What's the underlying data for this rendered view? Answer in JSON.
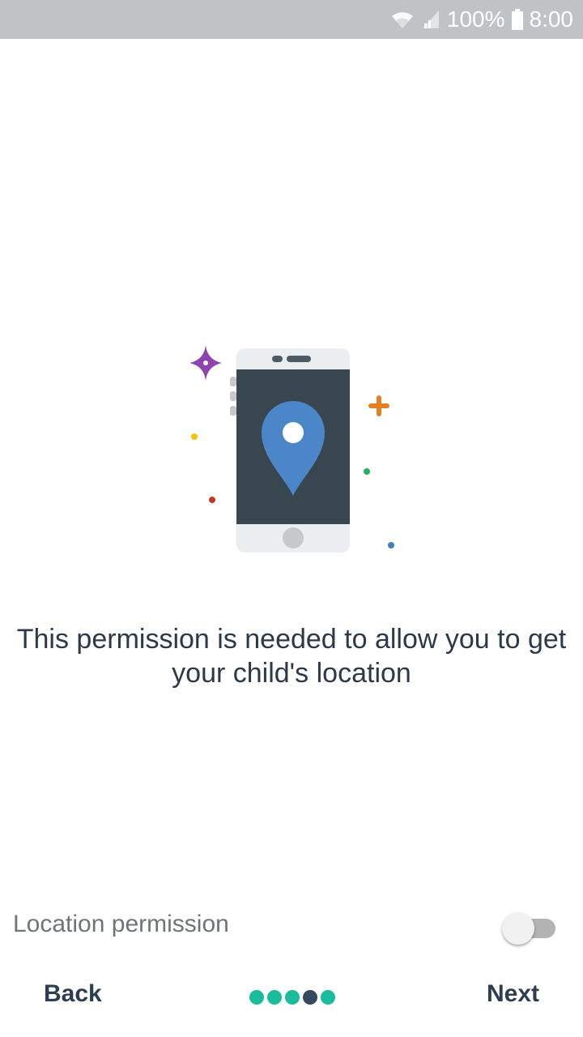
{
  "status_bar": {
    "battery": "100%",
    "time": "8:00",
    "wifi_icon": "wifi-icon",
    "signal_icon": "signal-icon",
    "battery_icon": "battery-icon"
  },
  "illustration": {
    "icon": "phone-location-pin-illustration",
    "colors": {
      "phone_body": "#ebeef0",
      "phone_screen": "#37464f",
      "pin": "#4a86c8",
      "sparkle_purple": "#8e44ad",
      "plus_orange": "#e67e22",
      "dot_yellow": "#f1c40f",
      "dot_red": "#c0392b",
      "dot_green": "#27ae60",
      "dot_blue": "#3d7fc1"
    }
  },
  "message": "This permission is needed to allow you to get your child's location",
  "permission": {
    "label": "Location permission",
    "enabled": false
  },
  "navigation": {
    "back_label": "Back",
    "next_label": "Next",
    "total_steps": 5,
    "current_step": 4,
    "dot_color": "#1abc9c",
    "active_dot_color": "#34495e"
  }
}
